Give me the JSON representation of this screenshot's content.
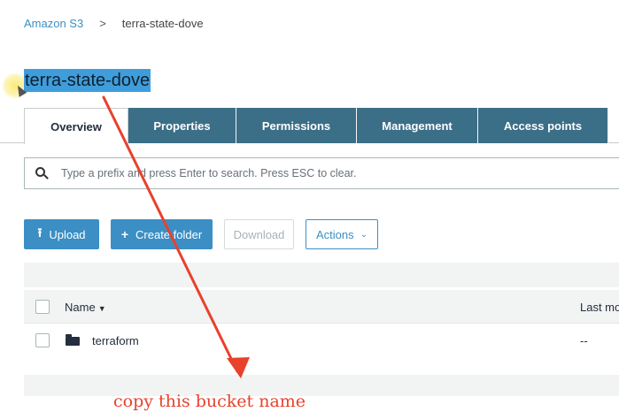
{
  "breadcrumb": {
    "root": "Amazon S3",
    "separator": ">",
    "current": "terra-state-dove"
  },
  "bucket": {
    "title": "terra-state-dove"
  },
  "tabs": [
    {
      "label": "Overview",
      "active": true
    },
    {
      "label": "Properties",
      "active": false
    },
    {
      "label": "Permissions",
      "active": false
    },
    {
      "label": "Management",
      "active": false
    },
    {
      "label": "Access points",
      "active": false
    }
  ],
  "search": {
    "placeholder": "Type a prefix and press Enter to search. Press ESC to clear.",
    "value": ""
  },
  "toolbar": {
    "upload_label": "Upload",
    "create_folder_label": "Create folder",
    "download_label": "Download",
    "actions_label": "Actions"
  },
  "table": {
    "columns": {
      "name": "Name",
      "last_modified": "Last mo"
    },
    "rows": [
      {
        "type": "folder",
        "name": "terraform",
        "last_modified": "--"
      }
    ]
  },
  "annotation": {
    "text": "copy this bucket name",
    "color": "#e8412c"
  },
  "colors": {
    "accent": "#3b8fc4",
    "tab_inactive": "#3b6e87",
    "selection": "#3f9ddb"
  },
  "icons": {
    "search": "search-icon",
    "upload": "upload-icon",
    "plus": "plus-icon",
    "chevron": "chevron-down-icon",
    "sort": "sort-down-icon",
    "folder": "folder-icon"
  }
}
